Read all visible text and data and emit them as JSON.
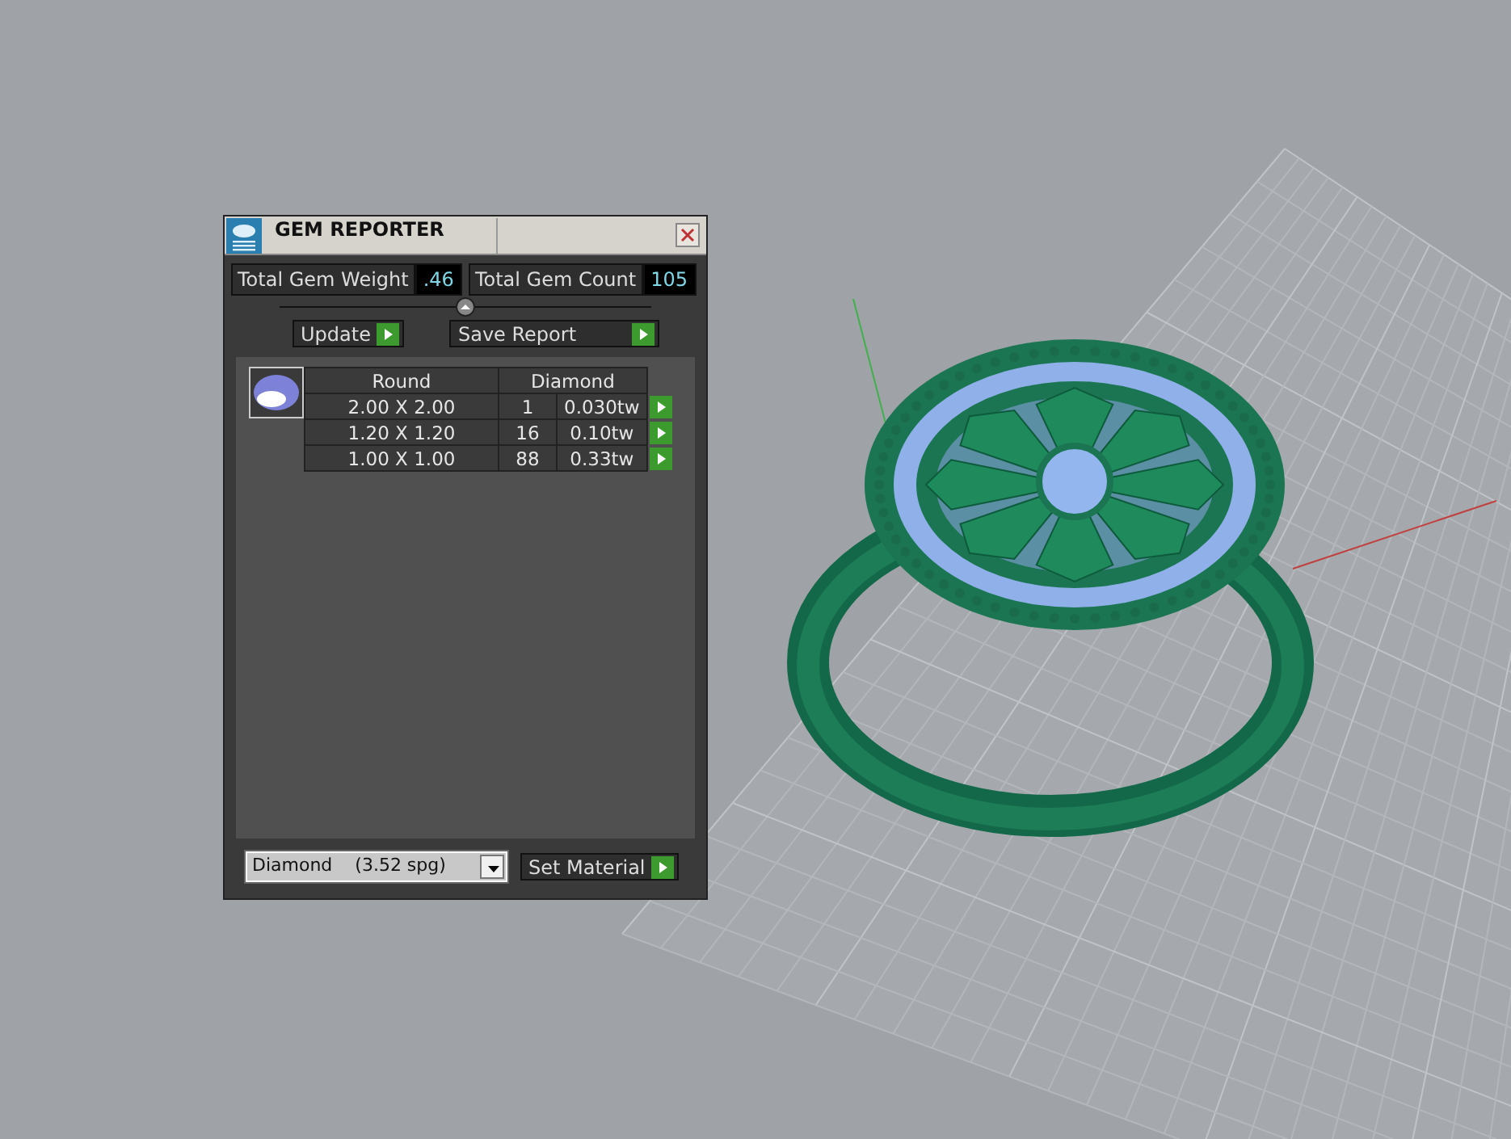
{
  "panel": {
    "title": "GEM REPORTER",
    "totals": [
      {
        "label": "Total Gem Weight",
        "value": ".46"
      },
      {
        "label": "Total Gem Count",
        "value": "105"
      }
    ],
    "buttons": [
      "Update",
      "Save Report"
    ],
    "table": {
      "columns": [
        "Round",
        "Diamond"
      ],
      "rows": [
        {
          "size": "2.00 X 2.00",
          "count": "1",
          "weight": "0.030tw"
        },
        {
          "size": "1.20 X 1.20",
          "count": "16",
          "weight": "0.10tw"
        },
        {
          "size": "1.00 X 1.00",
          "count": "88",
          "weight": "0.33tw"
        }
      ]
    },
    "material": {
      "value": "Diamond    (3.52 spg)"
    },
    "material_button": "Set Material"
  }
}
